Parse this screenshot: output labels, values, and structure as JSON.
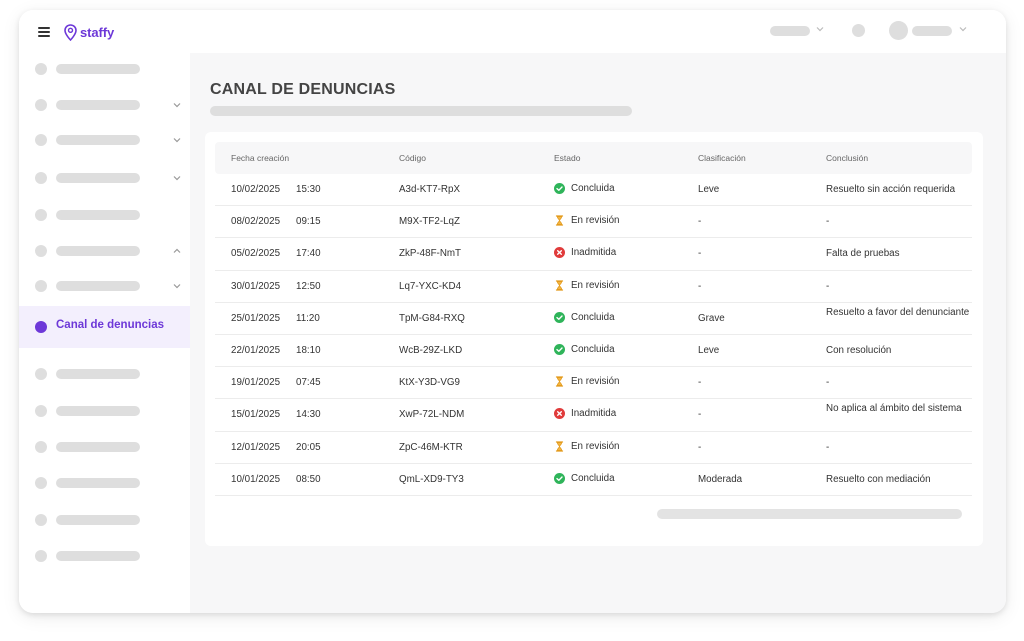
{
  "header": {
    "logo_text": "staffy",
    "colors": {
      "brand": "#6d38d8",
      "skeleton": "#dedede"
    }
  },
  "sidebar": {
    "active_label": "Canal de denuncias"
  },
  "main": {
    "title": "CANAL DE DENUNCIAS",
    "table": {
      "columns": [
        "Fecha creación",
        "Código",
        "Estado",
        "Clasificación",
        "Conclusión"
      ],
      "rows": [
        {
          "date": "10/02/2025",
          "time": "15:30",
          "code": "A3d-KT7-RpX",
          "state": "Concluida",
          "state_icon": "check-circle-icon",
          "classification": "Leve",
          "conclusion": "Resuelto sin acción requerida"
        },
        {
          "date": "08/02/2025",
          "time": "09:15",
          "code": "M9X-TF2-LqZ",
          "state": "En revisión",
          "state_icon": "hourglass-icon",
          "classification": "-",
          "conclusion": "-"
        },
        {
          "date": "05/02/2025",
          "time": "17:40",
          "code": "ZkP-48F-NmT",
          "state": "Inadmitida",
          "state_icon": "x-circle-icon",
          "classification": "-",
          "conclusion": "Falta de pruebas"
        },
        {
          "date": "30/01/2025",
          "time": "12:50",
          "code": "Lq7-YXC-KD4",
          "state": "En revisión",
          "state_icon": "hourglass-icon",
          "classification": "-",
          "conclusion": "-"
        },
        {
          "date": "25/01/2025",
          "time": "11:20",
          "code": "TpM-G84-RXQ",
          "state": "Concluida",
          "state_icon": "check-circle-icon",
          "classification": "Grave",
          "conclusion": "Resuelto a favor del denunciante"
        },
        {
          "date": "22/01/2025",
          "time": "18:10",
          "code": "WcB-29Z-LKD",
          "state": "Concluida",
          "state_icon": "check-circle-icon",
          "classification": "Leve",
          "conclusion": "Con resolución"
        },
        {
          "date": "19/01/2025",
          "time": "07:45",
          "code": "KtX-Y3D-VG9",
          "state": "En revisión",
          "state_icon": "hourglass-icon",
          "classification": "-",
          "conclusion": "-"
        },
        {
          "date": "15/01/2025",
          "time": "14:30",
          "code": "XwP-72L-NDM",
          "state": "Inadmitida",
          "state_icon": "x-circle-icon",
          "classification": "-",
          "conclusion": "No aplica al ámbito del sistema"
        },
        {
          "date": "12/01/2025",
          "time": "20:05",
          "code": "ZpC-46M-KTR",
          "state": "En revisión",
          "state_icon": "hourglass-icon",
          "classification": "-",
          "conclusion": "-"
        },
        {
          "date": "10/01/2025",
          "time": "08:50",
          "code": "QmL-XD9-TY3",
          "state": "Concluida",
          "state_icon": "check-circle-icon",
          "classification": "Moderada",
          "conclusion": "Resuelto con mediación"
        }
      ]
    },
    "status_colors": {
      "Concluida": "#2fb45a",
      "En revisión": "#e39a1c",
      "Inadmitida": "#e03b3b"
    }
  }
}
